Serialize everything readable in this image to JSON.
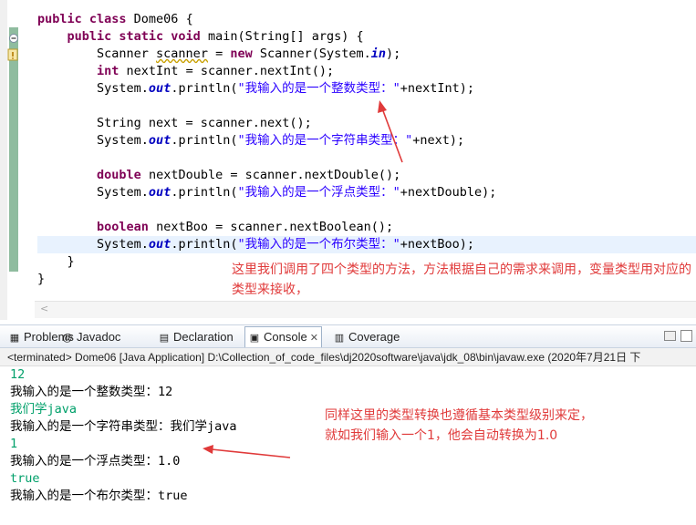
{
  "editor": {
    "code": [
      {
        "parts": [
          {
            "t": "public class ",
            "c": "kw"
          },
          {
            "t": "Dome06 {",
            "c": ""
          }
        ]
      },
      {
        "parts": [
          {
            "t": "    ",
            "c": ""
          },
          {
            "t": "public static void ",
            "c": "kw"
          },
          {
            "t": "main(String[] args) {",
            "c": ""
          }
        ]
      },
      {
        "parts": [
          {
            "t": "        Scanner ",
            "c": ""
          },
          {
            "t": "scanner",
            "c": "warn"
          },
          {
            "t": " = ",
            "c": ""
          },
          {
            "t": "new ",
            "c": "kw"
          },
          {
            "t": "Scanner(System.",
            "c": ""
          },
          {
            "t": "in",
            "c": "fld"
          },
          {
            "t": ");",
            "c": ""
          }
        ]
      },
      {
        "parts": [
          {
            "t": "        ",
            "c": ""
          },
          {
            "t": "int ",
            "c": "kw"
          },
          {
            "t": "nextInt = scanner.nextInt();",
            "c": ""
          }
        ]
      },
      {
        "parts": [
          {
            "t": "        System.",
            "c": ""
          },
          {
            "t": "out",
            "c": "fld"
          },
          {
            "t": ".println(",
            "c": ""
          },
          {
            "t": "\"我输入的是一个整数类型：\"",
            "c": "str"
          },
          {
            "t": "+nextInt);",
            "c": ""
          }
        ]
      },
      {
        "parts": []
      },
      {
        "parts": [
          {
            "t": "        String next = scanner.next();",
            "c": ""
          }
        ]
      },
      {
        "parts": [
          {
            "t": "        System.",
            "c": ""
          },
          {
            "t": "out",
            "c": "fld"
          },
          {
            "t": ".println(",
            "c": ""
          },
          {
            "t": "\"我输入的是一个字符串类型：\"",
            "c": "str"
          },
          {
            "t": "+next);",
            "c": ""
          }
        ]
      },
      {
        "parts": []
      },
      {
        "parts": [
          {
            "t": "        ",
            "c": ""
          },
          {
            "t": "double ",
            "c": "kw"
          },
          {
            "t": "nextDouble = scanner.nextDouble();",
            "c": ""
          }
        ]
      },
      {
        "parts": [
          {
            "t": "        System.",
            "c": ""
          },
          {
            "t": "out",
            "c": "fld"
          },
          {
            "t": ".println(",
            "c": ""
          },
          {
            "t": "\"我输入的是一个浮点类型：\"",
            "c": "str"
          },
          {
            "t": "+nextDouble);",
            "c": ""
          }
        ]
      },
      {
        "parts": []
      },
      {
        "parts": [
          {
            "t": "        ",
            "c": ""
          },
          {
            "t": "boolean ",
            "c": "kw"
          },
          {
            "t": "nextBoo = scanner.nextBoolean();",
            "c": ""
          }
        ]
      },
      {
        "parts": [
          {
            "t": "        System.",
            "c": ""
          },
          {
            "t": "out",
            "c": "fld"
          },
          {
            "t": ".println(",
            "c": ""
          },
          {
            "t": "\"我输入的是一个布尔类型：\"",
            "c": "str"
          },
          {
            "t": "+nextBoo);",
            "c": ""
          }
        ]
      },
      {
        "parts": [
          {
            "t": "    }",
            "c": ""
          }
        ]
      },
      {
        "parts": [
          {
            "t": "}",
            "c": ""
          }
        ]
      }
    ],
    "annotation_top": "这里我们调用了四个类型的方法，方法根据自己的需求来调用，变量类型用对应的类型来接收，"
  },
  "tabs": [
    {
      "label": "Problems",
      "icon": "problems-icon",
      "glyph": "▦"
    },
    {
      "label": "Javadoc",
      "icon": "javadoc-icon",
      "glyph": "@"
    },
    {
      "label": "Declaration",
      "icon": "declaration-icon",
      "glyph": "▤"
    },
    {
      "label": "Console",
      "icon": "console-icon",
      "glyph": "▣",
      "close": "✕"
    },
    {
      "label": "Coverage",
      "icon": "coverage-icon",
      "glyph": "▥"
    }
  ],
  "console": {
    "status": "<terminated> Dome06 [Java Application] D:\\Collection_of_code_files\\dj2020software\\java\\jdk_08\\bin\\javaw.exe  (2020年7月21日 下",
    "lines": [
      {
        "text": "12",
        "kind": "in"
      },
      {
        "text": "我输入的是一个整数类型：12",
        "kind": "std"
      },
      {
        "text": "我们学java",
        "kind": "in"
      },
      {
        "text": "我输入的是一个字符串类型：我们学java",
        "kind": "std"
      },
      {
        "text": "1",
        "kind": "in"
      },
      {
        "text": "我输入的是一个浮点类型：1.0",
        "kind": "std"
      },
      {
        "text": "true",
        "kind": "in"
      },
      {
        "text": "我输入的是一个布尔类型：true",
        "kind": "std"
      }
    ],
    "annotation_line1": "同样这里的类型转换也遵循基本类型级别来定，",
    "annotation_line2": "就如我们输入一个1，他会自动转换为1.0"
  },
  "scroll_left_glyph": "<",
  "colors": {
    "annotation": "#e03a3a",
    "keyword": "#7f0055",
    "string": "#2a00ff",
    "console_input": "#00a06a"
  }
}
